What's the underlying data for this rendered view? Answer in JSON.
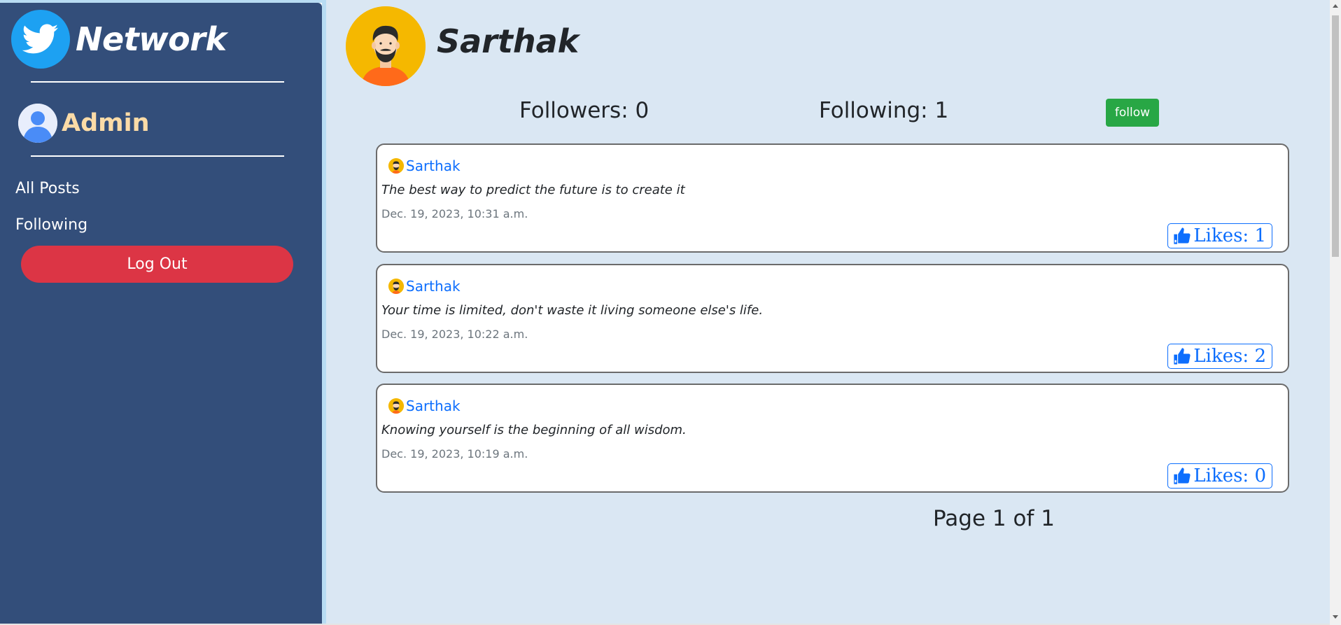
{
  "sidebar": {
    "brand": "Network",
    "username": "Admin",
    "nav": [
      {
        "label": "All Posts"
      },
      {
        "label": "Following"
      }
    ],
    "logout_label": "Log Out"
  },
  "profile": {
    "name": "Sarthak",
    "followers_text": "Followers: 0",
    "following_text": "Following: 1",
    "follow_label": "follow"
  },
  "posts": [
    {
      "author": "Sarthak",
      "content": "The best way to predict the future is to create it",
      "timestamp": "Dec. 19, 2023, 10:31 a.m.",
      "likes_text": "Likes: 1"
    },
    {
      "author": "Sarthak",
      "content": "Your time is limited, don't waste it living someone else's life.",
      "timestamp": "Dec. 19, 2023, 10:22 a.m.",
      "likes_text": "Likes: 2"
    },
    {
      "author": "Sarthak",
      "content": "Knowing yourself is the beginning of all wisdom.",
      "timestamp": "Dec. 19, 2023, 10:19 a.m.",
      "likes_text": "Likes: 0"
    }
  ],
  "pagination": {
    "text": "Page 1 of 1"
  },
  "icons": {
    "brand": "twitter-bird-icon",
    "user": "user-avatar-icon",
    "like": "thumbs-up-icon"
  },
  "colors": {
    "sidebar_bg": "#334e7a",
    "main_bg": "#dae7f3",
    "logout": "#dc3545",
    "follow": "#28a745",
    "link": "#0d6efd",
    "username": "#fbdba7"
  }
}
